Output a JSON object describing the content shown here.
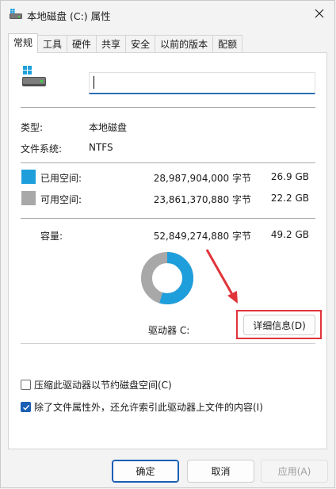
{
  "window": {
    "title": "本地磁盘 (C:) 属性",
    "close_icon": "close-icon"
  },
  "tabs": [
    {
      "label": "常规",
      "active": true
    },
    {
      "label": "工具"
    },
    {
      "label": "硬件"
    },
    {
      "label": "共享"
    },
    {
      "label": "安全"
    },
    {
      "label": "以前的版本"
    },
    {
      "label": "配额"
    }
  ],
  "general": {
    "name_value": "",
    "type_label": "类型:",
    "type_value": "本地磁盘",
    "fs_label": "文件系统:",
    "fs_value": "NTFS",
    "used": {
      "label": "已用空间:",
      "bytes": "28,987,904,000 字节",
      "size": "26.9 GB",
      "color": "#1e9fdc"
    },
    "free": {
      "label": "可用空间:",
      "bytes": "23,861,370,880 字节",
      "size": "22.2 GB",
      "color": "#a8a8a8"
    },
    "capacity": {
      "label": "容量:",
      "bytes": "52,849,274,880 字节",
      "size": "49.2 GB"
    },
    "drive_label": "驱动器 C:",
    "details_button": "详细信息(D)",
    "used_fraction": 0.548,
    "highlight_color": "#e0343a"
  },
  "options": {
    "compress": {
      "label": "压缩此驱动器以节约磁盘空间(C)",
      "checked": false
    },
    "index": {
      "label": "除了文件属性外，还允许索引此驱动器上文件的内容(I)",
      "checked": true
    }
  },
  "buttons": {
    "ok": "确定",
    "cancel": "取消",
    "apply": "应用(A)"
  }
}
